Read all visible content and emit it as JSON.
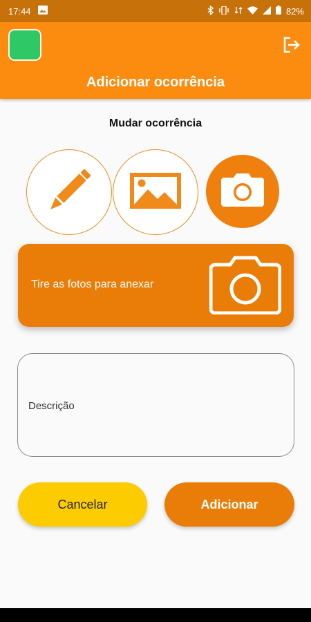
{
  "status_bar": {
    "time": "17:44",
    "battery": "82%",
    "icons": [
      "image-icon",
      "bluetooth-icon",
      "vibrate-icon",
      "data-icon",
      "wifi-icon",
      "signal-icon",
      "battery-icon"
    ]
  },
  "app_bar": {
    "title": "Adicionar ocorrência",
    "logo_color": "#2ec866",
    "logout_icon": "logout-icon"
  },
  "main": {
    "section_title": "Mudar ocorrência",
    "modes": [
      {
        "icon": "pencil-icon",
        "active": false
      },
      {
        "icon": "image-icon",
        "active": false
      },
      {
        "icon": "camera-icon",
        "active": true
      }
    ],
    "banner_text": "Tire as fotos para anexar",
    "description_label": "Descrição"
  },
  "buttons": {
    "cancel": "Cancelar",
    "add": "Adicionar"
  },
  "colors": {
    "accent": "#fb8c0f",
    "status_bar": "#c7710a",
    "cancel": "#fdcc00",
    "primary_button": "#e97d08"
  }
}
